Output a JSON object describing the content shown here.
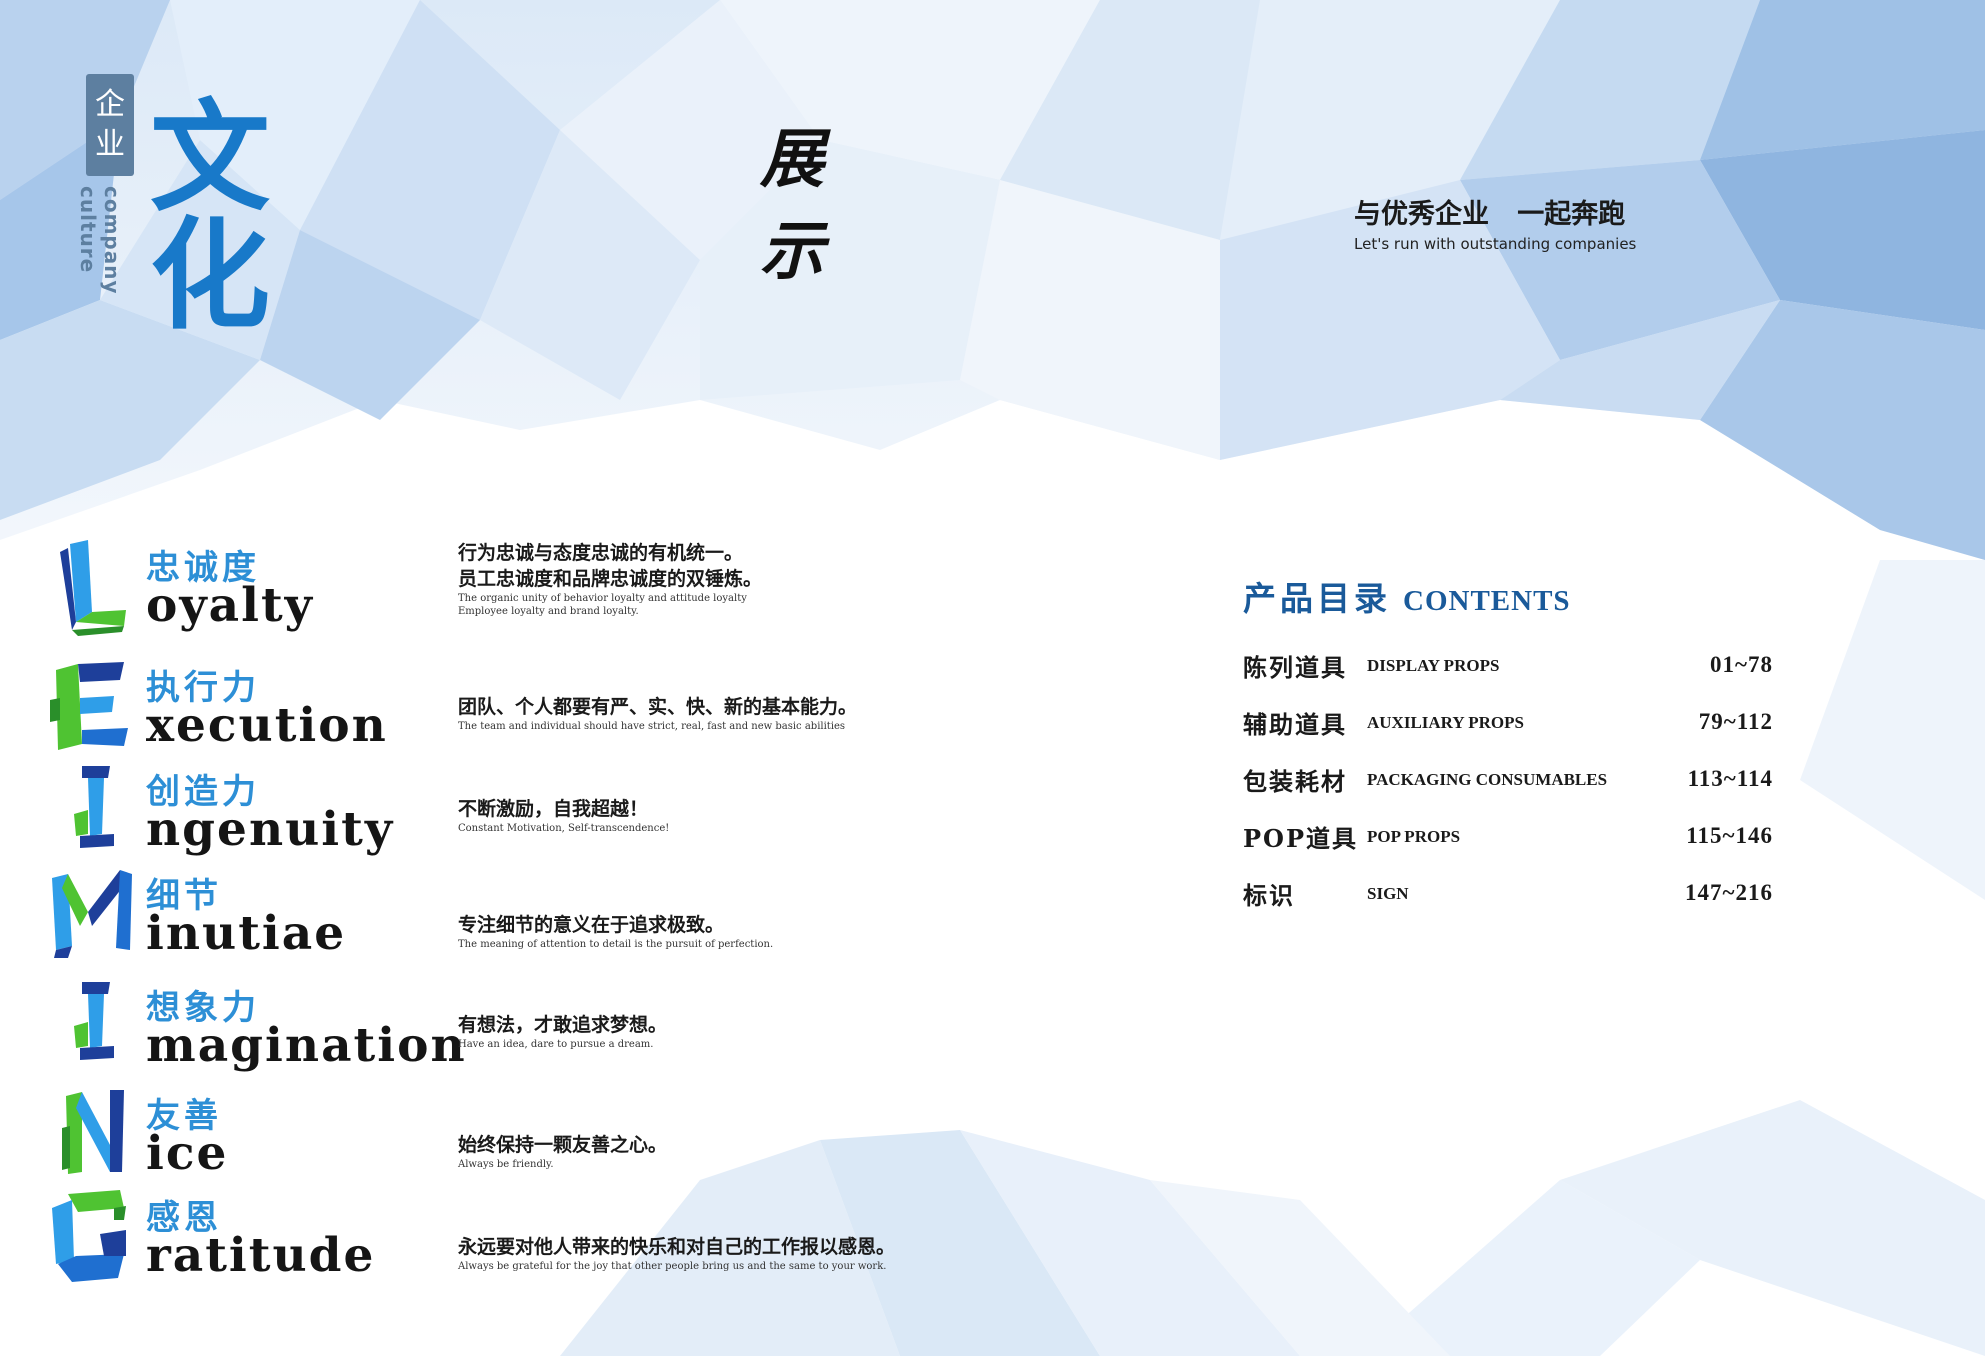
{
  "header": {
    "vertical_tag": [
      "企",
      "业"
    ],
    "vertical_caption": "company culture",
    "big_title": [
      "文",
      "化"
    ],
    "center_title": "展 示",
    "slogan_cn": "与优秀企业   一起奔跑",
    "slogan_en": "Let's run with outstanding companies"
  },
  "values": [
    {
      "letter": "L",
      "cn": "忠诚度",
      "en": "oyalty",
      "desc_cn": [
        "行为忠诚与态度忠诚的有机统一。",
        "员工忠诚度和品牌忠诚度的双锤炼。"
      ],
      "desc_en": [
        "The organic unity of behavior loyalty and attitude loyalty",
        "Employee loyalty and brand loyalty."
      ]
    },
    {
      "letter": "E",
      "cn": "执行力",
      "en": "xecution",
      "desc_cn": [
        "团队、个人都要有严、实、快、新的基本能力。"
      ],
      "desc_en": [
        "The team and individual should have strict, real, fast and new basic abilities"
      ]
    },
    {
      "letter": "I",
      "cn": "创造力",
      "en": "ngenuity",
      "desc_cn": [
        "不断激励，自我超越！"
      ],
      "desc_en": [
        "Constant Motivation, Self-transcendence!"
      ]
    },
    {
      "letter": "M",
      "cn": "细节",
      "en": "inutiae",
      "desc_cn": [
        "专注细节的意义在于追求极致。"
      ],
      "desc_en": [
        "The meaning of attention to detail is the pursuit of perfection."
      ]
    },
    {
      "letter": "I",
      "cn": "想象力",
      "en": "magination",
      "desc_cn": [
        "有想法，才敢追求梦想。"
      ],
      "desc_en": [
        "Have an idea, dare to pursue a dream."
      ]
    },
    {
      "letter": "N",
      "cn": "友善",
      "en": "ice",
      "desc_cn": [
        "始终保持一颗友善之心。"
      ],
      "desc_en": [
        "Always be friendly."
      ]
    },
    {
      "letter": "G",
      "cn": "感恩",
      "en": "ratitude",
      "desc_cn": [
        "永远要对他人带来的快乐和对自己的工作报以感恩。"
      ],
      "desc_en": [
        "Always be grateful for the joy that other people bring us and the same to your work."
      ]
    }
  ],
  "contents": {
    "title_cn": "产品目录",
    "title_en": "CONTENTS",
    "items": [
      {
        "cn": "陈列道具",
        "en": "DISPLAY PROPS",
        "pages": "01~78"
      },
      {
        "cn": "辅助道具",
        "en": "AUXILIARY PROPS",
        "pages": "79~112"
      },
      {
        "cn": "包装耗材",
        "en": "PACKAGING CONSUMABLES",
        "pages": "113~114"
      },
      {
        "cn": "POP道具",
        "en": "POP PROPS",
        "pages": "115~146"
      },
      {
        "cn": "标识",
        "en": "SIGN",
        "pages": "147~216"
      }
    ]
  },
  "colors": {
    "accent_blue": "#1879c9",
    "caption_blue": "#5d7fa0",
    "green": "#5cc23a",
    "dark_blue": "#1a3f9a"
  },
  "icons": [
    "letter-L-icon",
    "letter-E-icon",
    "letter-I-icon",
    "letter-M-icon",
    "letter-I-icon",
    "letter-N-icon",
    "letter-G-icon"
  ]
}
